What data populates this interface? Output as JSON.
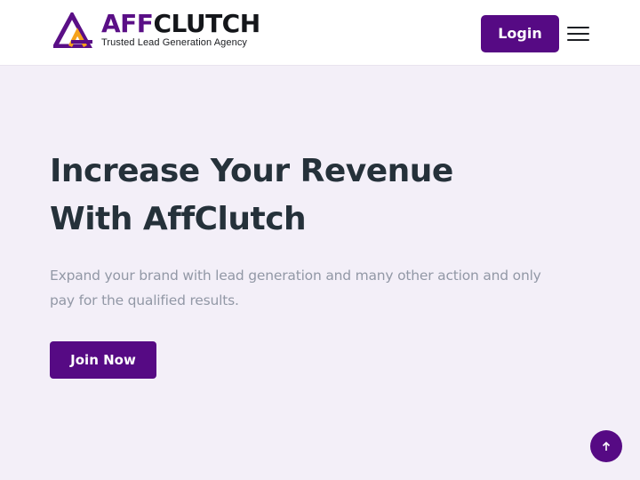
{
  "brand": {
    "name_accent": "AFF",
    "name_rest": "CLUTCH",
    "tagline": "Trusted Lead Generation Agency",
    "accent_color": "#5a0f86",
    "orange_color": "#f5a21b"
  },
  "header": {
    "login_label": "Login",
    "menu_icon": "hamburger-menu-icon"
  },
  "hero": {
    "title_lines": [
      "Increase Your Revenue",
      "With AffClutch"
    ],
    "description_lines": [
      "Expand your brand with lead generation and many other action and only",
      "pay for the qualified results."
    ],
    "cta_label": "Join Now"
  },
  "scroll_top": {
    "icon": "arrow-up-icon"
  },
  "colors": {
    "primary": "#560a84",
    "background": "#f3eff8",
    "heading": "#25313a",
    "muted": "#9298a6"
  }
}
